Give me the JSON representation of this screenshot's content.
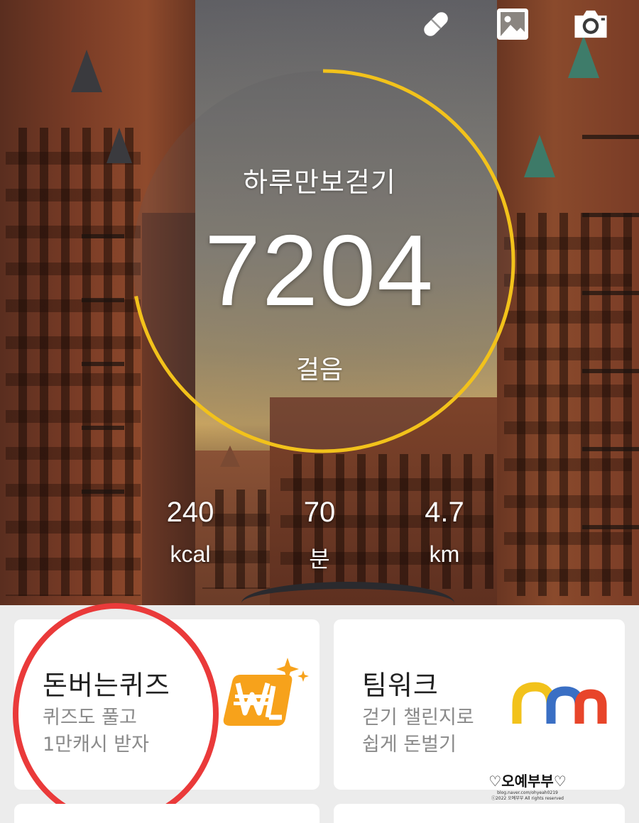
{
  "toolbar": {
    "icons": [
      "pill-icon",
      "image-icon",
      "camera-icon"
    ]
  },
  "progress": {
    "title": "하루만보걷기",
    "count": "7204",
    "unit": "걸음",
    "goal_fraction": 0.7204,
    "ring_color": "#f2c21b"
  },
  "stats": [
    {
      "value": "240",
      "unit": "kcal"
    },
    {
      "value": "70",
      "unit": "분"
    },
    {
      "value": "4.7",
      "unit": "km"
    }
  ],
  "cards": {
    "quiz": {
      "title": "돈버는퀴즈",
      "line1": "퀴즈도 풀고",
      "line2": "1만캐시 받자",
      "icon": "won-sparkle-icon"
    },
    "teamwork": {
      "title": "팀워크",
      "line1": "걷기 챌린지로",
      "line2": "쉽게 돈벌기",
      "icon": "team-bars-icon"
    }
  },
  "watermark": {
    "name": "♡오예부부♡",
    "url": "blog.naver.com/ohyeah0219",
    "copyright": "ⓒ2022 오예부부 All rights reserved"
  },
  "colors": {
    "accent": "#f2c21b",
    "highlight": "#ea3a3a",
    "card_bg": "#ffffff",
    "page_bg": "#ececec"
  }
}
